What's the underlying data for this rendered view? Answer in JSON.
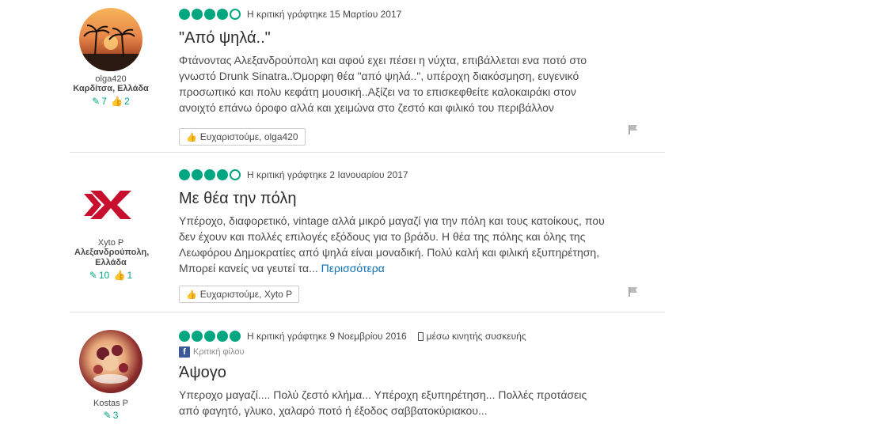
{
  "reviews": [
    {
      "member": {
        "username": "olga420",
        "location": "Καρδίτσα, Ελλάδα",
        "reviews_count": "7",
        "helpful_count": "2",
        "avatar": "sunset-palms-avatar"
      },
      "rating": 4,
      "date": "Η κριτική γράφτηκε 15 Μαρτίου 2017",
      "title": "\"Από ψηλά..\"",
      "text": "Φτάνοντας Αλεξανδρούπολη και αφού εχει πέσει η νύχτα, επιβάλλεται ενα ποτό στο γνωστό Drunk Sinatra..Όμορφη θέα \"από ψηλά..\", υπέροχη διακόσμηση, ευγενικό προσωπικό και πολυ κεφάτη μουσική..Αξίζει να το επισκεφθείτε καλοκαιράκι στον ανοιχτό επάνω όροφο αλλά και χειμώνα στο ζεστό και φιλικό του περιβάλλον",
      "thank_label": "Ευχαριστούμε, olga420"
    },
    {
      "member": {
        "username": "Xyto P",
        "location": "Αλεξανδρούπολη, Ελλάδα",
        "reviews_count": "10",
        "helpful_count": "1",
        "avatar": "red-x-logo-avatar"
      },
      "rating": 4,
      "date": "Η κριτική γράφτηκε 2 Ιανουαρίου 2017",
      "title": "Με θέα την πόλη",
      "text": "Υπέροχο, διαφορετικό, vintage αλλά μικρό μαγαζί για την πόλη και τους κατοίκους, που δεν έχουν και πολλές επιλογές εξόδους για το βράδυ. Η θέα της πόλης και όλης της Λεωφόρου Δημοκρατίες από ψηλά είναι μοναδική. Πολύ καλή και φιλική εξυπηρέτηση, Μπορεί κανείς να γευτεί τα...",
      "more_label": "Περισσότερα",
      "thank_label": "Ευχαριστούμε, Xyto P"
    },
    {
      "member": {
        "username": "Kostas P",
        "reviews_count": "3",
        "avatar": "food-dessert-avatar"
      },
      "rating": 5,
      "date": "Η κριτική γράφτηκε 9 Νοεμβρίου 2016",
      "mobile_label": "μέσω κινητής συσκευής",
      "fb_label": "Κριτική φίλου",
      "title": "Άψογο",
      "text": "Υπεροχο μαγαζί.... Πολύ ζεστό κλήμα... Υπέροχη εξυπηρέτηση... Πολλές προτάσεις από φαγητό, γλυκο, χαλαρό ποτό ή έξοδος σαββατοκύριακου..."
    }
  ],
  "colors": {
    "accent": "#00a680",
    "link": "#0a6fb6",
    "facebook": "#3b5998"
  }
}
